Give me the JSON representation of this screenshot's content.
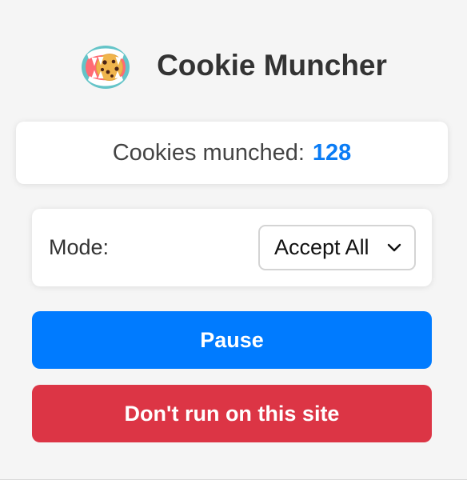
{
  "header": {
    "logo_icon": "cookie-mouth-icon",
    "title": "Cookie Muncher"
  },
  "counter": {
    "label": "Cookies munched:",
    "value": "128",
    "value_color": "#0a7cf5"
  },
  "mode": {
    "label": "Mode:",
    "selected": "Accept All",
    "dropdown_icon": "chevron-down-icon"
  },
  "buttons": {
    "pause": "Pause",
    "disable_site": "Don't run on this site"
  },
  "colors": {
    "background": "#f5f5f5",
    "primary": "#007bff",
    "danger": "#dc3545"
  }
}
